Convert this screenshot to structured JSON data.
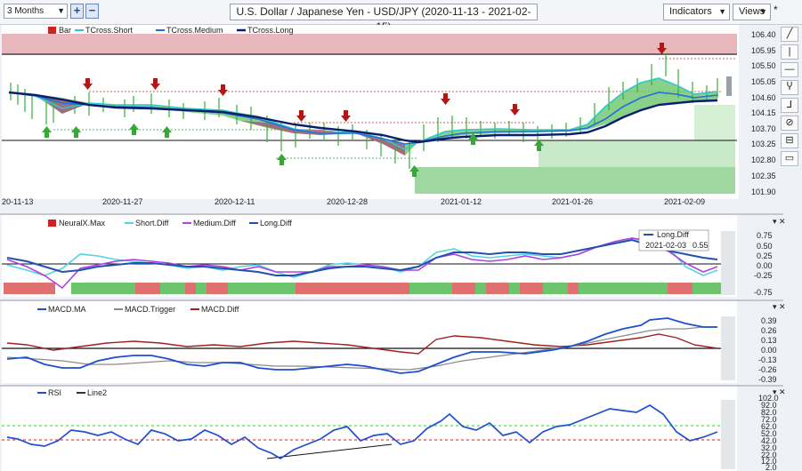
{
  "toolbar": {
    "period": "3 Months",
    "zoom_in": "+",
    "zoom_out": "−",
    "title": "U.S. Dollar / Japanese Yen - USD/JPY (2020-11-13 - 2021-02-15)",
    "indicators": "Indicators",
    "views": "Views",
    "star": "*"
  },
  "side_tools": [
    "╱",
    "|",
    "—",
    "Ⴤ",
    "⅃",
    "⊘",
    "⊟",
    "▭"
  ],
  "main_panel": {
    "legend": [
      {
        "label": "Bar",
        "color": "#cc2222"
      },
      {
        "label": "TCross.Short",
        "color": "#2fc8c8"
      },
      {
        "label": "TCross.Medium",
        "color": "#1f6fe0"
      },
      {
        "label": "TCross.Long",
        "color": "#0a1e6e"
      }
    ],
    "price_ticks": [
      "106.40",
      "105.95",
      "105.50",
      "105.05",
      "104.60",
      "104.15",
      "103.70",
      "103.25",
      "102.80",
      "102.35",
      "101.90"
    ],
    "date_ticks": [
      "20-11-13",
      "2020-11-27",
      "2020-12-11",
      "2020-12-28",
      "2021-01-12",
      "2021-01-26",
      "2021-02-09"
    ]
  },
  "diff_panel": {
    "legend": [
      {
        "label": "NeuralX.Max",
        "color": "#cc2222"
      },
      {
        "label": "Short.Diff",
        "color": "#4fd6e0"
      },
      {
        "label": "Medium.Diff",
        "color": "#b040e0"
      },
      {
        "label": "Long.Diff",
        "color": "#2050b0"
      }
    ],
    "ticks": [
      "0.75",
      "0.50",
      "0.25",
      "0.00",
      "-0.25",
      "-0.75"
    ],
    "tooltip": {
      "title": "Long.Diff",
      "date": "2021-02-03",
      "value": "0.55"
    }
  },
  "macd_panel": {
    "legend": [
      {
        "label": "MACD.MA",
        "color": "#1f4fd0"
      },
      {
        "label": "MACD.Trigger",
        "color": "#888888"
      },
      {
        "label": "MACD.Diff",
        "color": "#a02020"
      }
    ],
    "ticks": [
      "0.39",
      "0.26",
      "0.13",
      "0.00",
      "-0.13",
      "-0.26",
      "-0.39"
    ]
  },
  "rsi_panel": {
    "legend": [
      {
        "label": "RSI",
        "color": "#1f4fd0"
      },
      {
        "label": "Line2",
        "color": "#333333"
      }
    ],
    "ticks": [
      "102.0",
      "92.0",
      "82.0",
      "72.0",
      "62.0",
      "52.0",
      "42.0",
      "32.0",
      "22.0",
      "12.0",
      "2.0"
    ]
  }
}
